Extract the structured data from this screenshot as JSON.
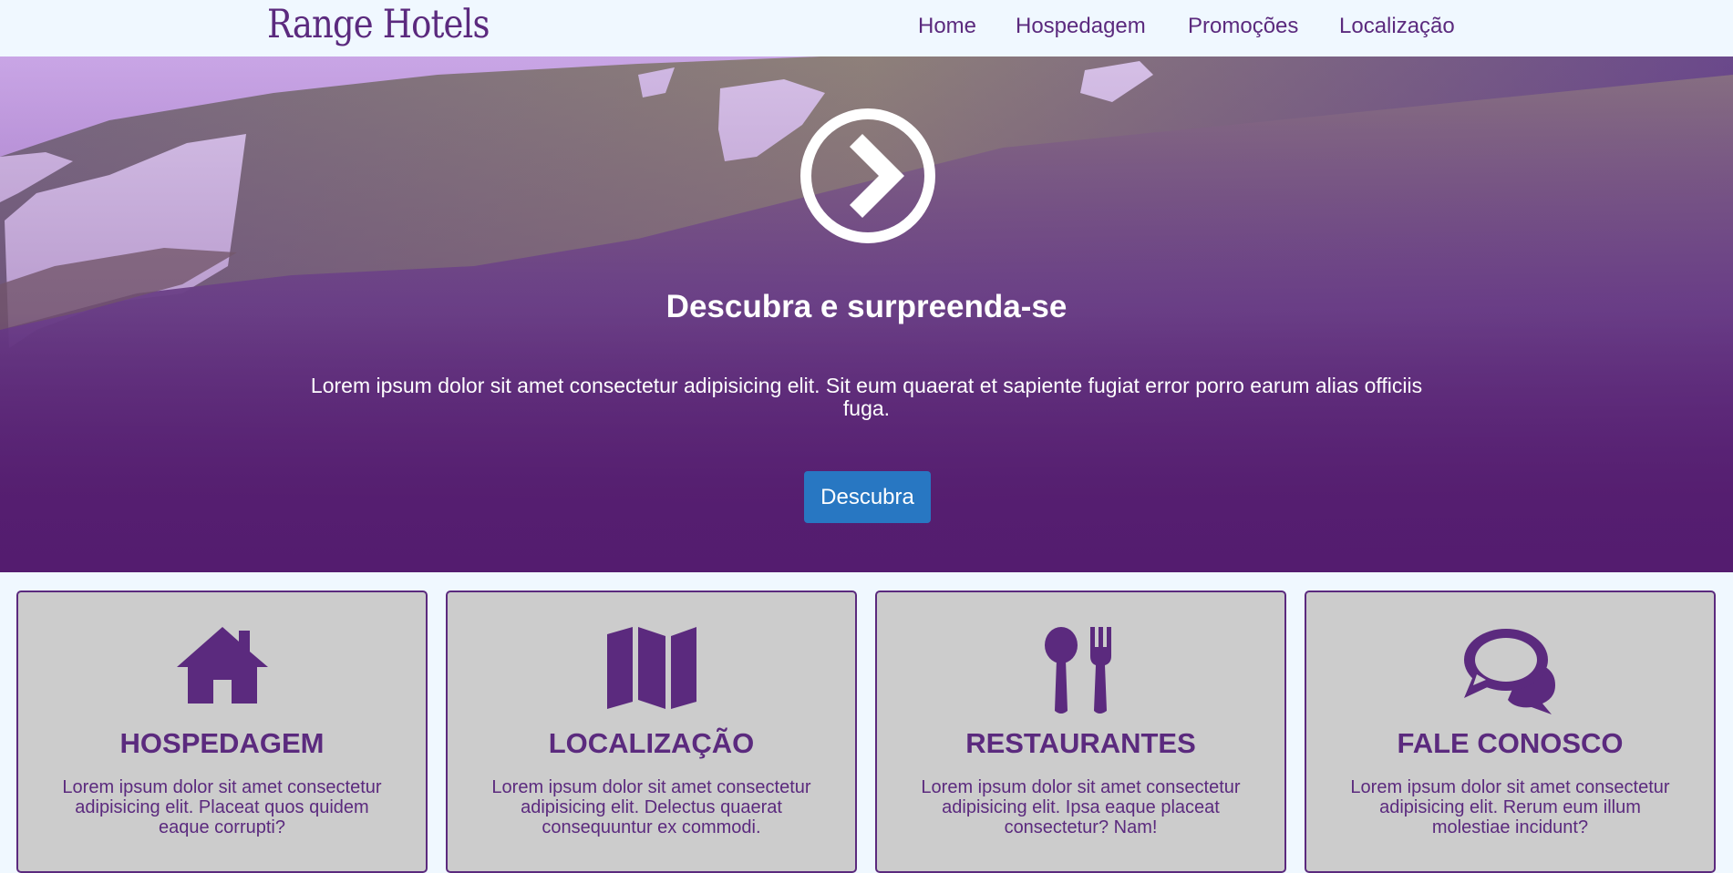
{
  "brand": {
    "name": "Range Hotels"
  },
  "nav": {
    "items": [
      {
        "label": "Home"
      },
      {
        "label": "Hospedagem"
      },
      {
        "label": "Promoções"
      },
      {
        "label": "Localização"
      }
    ]
  },
  "hero": {
    "icon": "chevron-circle-right-icon",
    "title": "Descubra e surpreenda-se",
    "text": "Lorem ipsum dolor sit amet consectetur adipisicing elit. Sit eum quaerat et sapiente fugiat error porro earum alias officiis fuga.",
    "button_label": "Descubra"
  },
  "cards": [
    {
      "icon": "home-icon",
      "title": "HOSPEDAGEM",
      "text": "Lorem ipsum dolor sit amet consectetur adipisicing elit. Placeat quos quidem eaque corrupti?"
    },
    {
      "icon": "map-icon",
      "title": "LOCALIZAÇÃO",
      "text": "Lorem ipsum dolor sit amet consectetur adipisicing elit. Delectus quaerat consequuntur ex commodi."
    },
    {
      "icon": "cutlery-icon",
      "title": "RESTAURANTES",
      "text": "Lorem ipsum dolor sit amet consectetur adipisicing elit. Ipsa eaque placeat consectetur? Nam!"
    },
    {
      "icon": "chat-bubbles-icon",
      "title": "FALE CONOSCO",
      "text": "Lorem ipsum dolor sit amet consectetur adipisicing elit. Rerum eum illum molestiae incidunt?"
    }
  ],
  "colors": {
    "brand_purple": "#5b2a7e",
    "page_background": "#f0f8ff",
    "button_blue": "#2877c2",
    "card_background": "#cccccc"
  }
}
